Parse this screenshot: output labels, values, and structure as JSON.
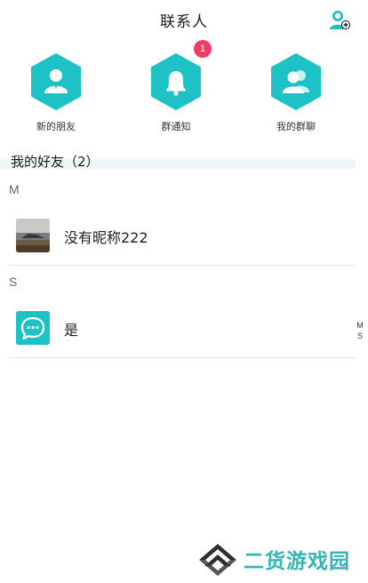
{
  "header": {
    "title": "联系人"
  },
  "quick_actions": [
    {
      "label": "新的朋友",
      "icon": "person-icon"
    },
    {
      "label": "群通知",
      "icon": "bell-icon",
      "badge": "1"
    },
    {
      "label": "我的群聊",
      "icon": "group-icon"
    }
  ],
  "friends": {
    "heading": "我的好友（2）",
    "groups": [
      {
        "letter": "M",
        "items": [
          {
            "name": "没有昵称222",
            "avatar": "photo"
          }
        ]
      },
      {
        "letter": "S",
        "items": [
          {
            "name": "是",
            "avatar": "chat-bubble-icon"
          }
        ]
      }
    ]
  },
  "index_bar": [
    "M",
    "S"
  ],
  "watermark": {
    "text": "二货游戏园"
  },
  "colors": {
    "accent": "#1ec2c6",
    "badge": "#f23d63"
  }
}
